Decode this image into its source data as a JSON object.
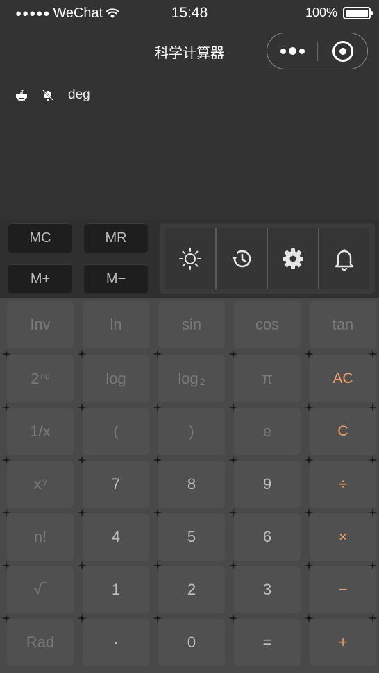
{
  "status": {
    "carrier": "WeChat",
    "time": "15:48",
    "battery": "100%"
  },
  "nav": {
    "title": "科学计算器"
  },
  "indicators": {
    "mode": "deg"
  },
  "memory": {
    "mc": "MC",
    "mr": "MR",
    "mplus": "M+",
    "mminus": "M−"
  },
  "tools": [
    "brightness-icon",
    "history-icon",
    "settings-icon",
    "bell-icon"
  ],
  "keys": {
    "inv": "Inv",
    "ln": "ln",
    "sin": "sin",
    "cos": "cos",
    "tan": "tan",
    "second": "2",
    "second_sup": "nd",
    "log": "log",
    "log2": "log",
    "log2_sub": "2",
    "pi": "π",
    "ac": "AC",
    "recip": "1/x",
    "lparen": "(",
    "rparen": ")",
    "e": "e",
    "c": "C",
    "pow": "x",
    "pow_sup": "y",
    "n7": "7",
    "n8": "8",
    "n9": "9",
    "div": "÷",
    "fact": "n!",
    "n4": "4",
    "n5": "5",
    "n6": "6",
    "mul": "×",
    "sqrt": "√‾",
    "n1": "1",
    "n2": "2",
    "n3": "3",
    "sub": "−",
    "rad": "Rad",
    "dot": "·",
    "n0": "0",
    "eq": "=",
    "add": "+"
  },
  "colors": {
    "accent": "#f2a168",
    "key_bg": "#505050",
    "keypad_bg": "#494949"
  }
}
